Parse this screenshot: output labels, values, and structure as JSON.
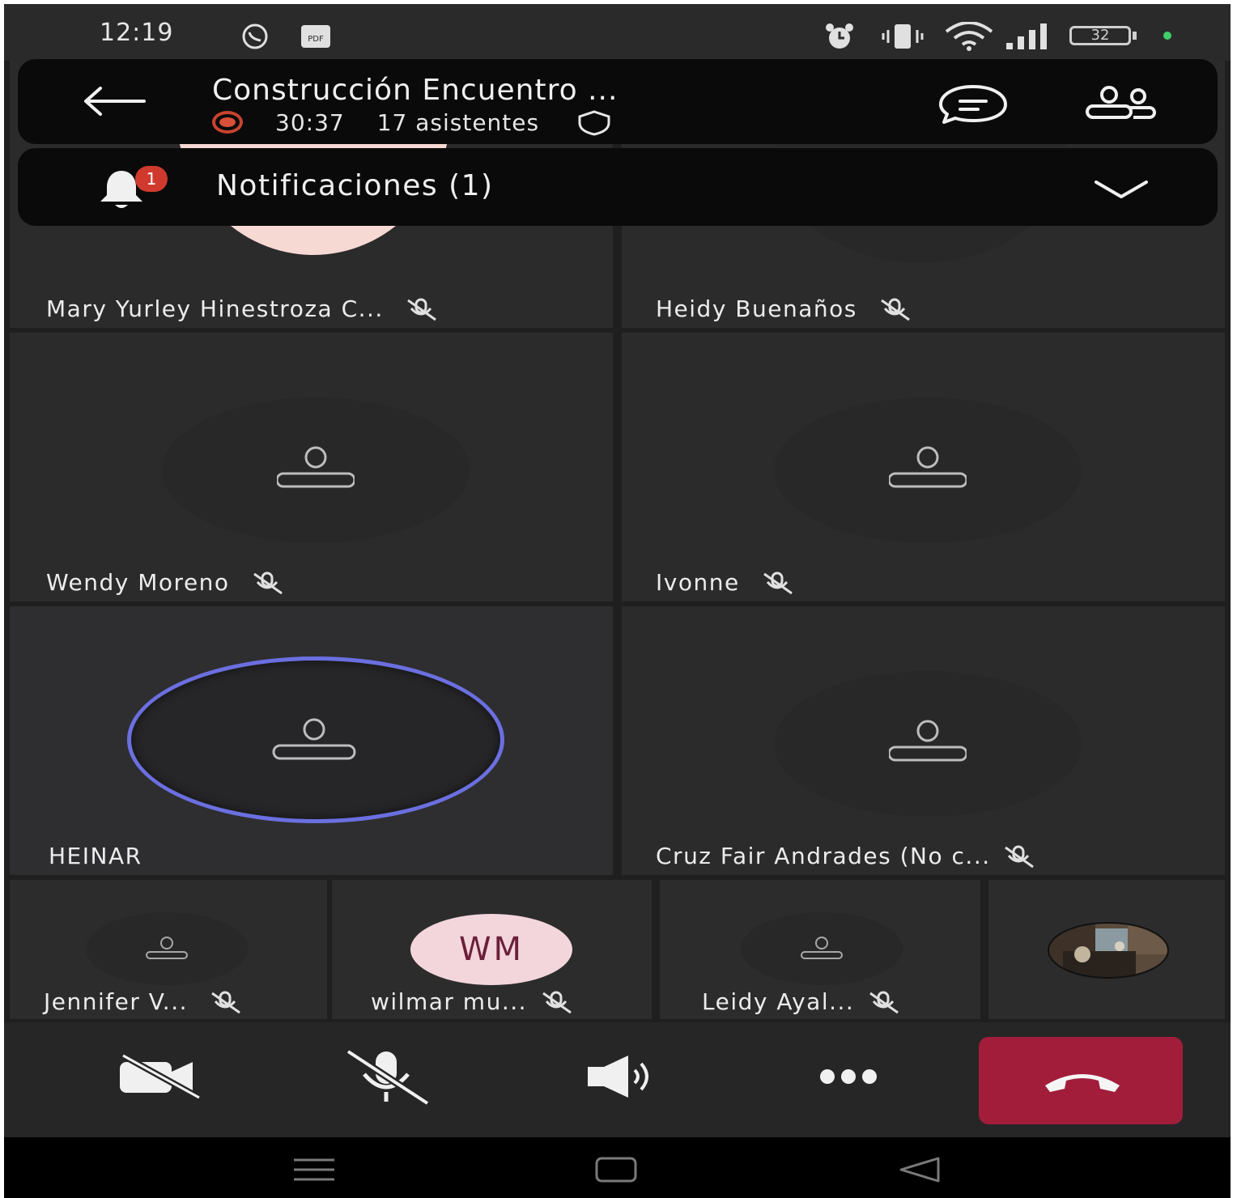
{
  "status_bar": {
    "time": "12:19",
    "battery": "32",
    "icons": [
      "whatsapp-icon",
      "pdf-icon",
      "alarm-icon",
      "vibrate-icon",
      "wifi-icon",
      "signal-icon",
      "battery-icon",
      "green-dot-icon"
    ]
  },
  "header": {
    "title": "Construcción Encuentro ...",
    "timer": "30:37",
    "attendees": "17 asistentes",
    "icons": [
      "back-arrow-icon",
      "recording-icon",
      "shield-icon",
      "chat-icon",
      "participants-icon"
    ]
  },
  "notifications": {
    "label": "Notificaciones (1)",
    "badge": "1"
  },
  "tiles": {
    "mary": "Mary Yurley Hinestroza C...",
    "heidy": "Heidy Buenaños",
    "wendy": "Wendy Moreno",
    "ivonne": "Ivonne",
    "heinar": "HEINAR",
    "cruz": "Cruz Fair Andrades  (No c...",
    "jennifer": "Jennifer V...",
    "wilmar": "wilmar mu...",
    "wilmar_initials": "WM",
    "leidy": "Leidy Ayal..."
  },
  "controls": [
    "camera-off-icon",
    "mic-off-icon",
    "speaker-icon",
    "more-icon",
    "hang-up-icon"
  ],
  "colors": {
    "hangup": "#a21d3a",
    "speaking_ring": "#6b6fe0",
    "recording": "#d9503a",
    "wm_avatar_bg": "#f3d6dc",
    "wm_avatar_text": "#6b1f3a"
  }
}
